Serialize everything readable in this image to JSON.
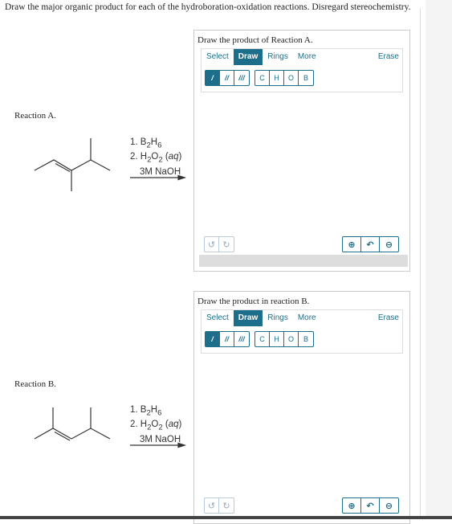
{
  "instructions": "Draw the major organic product for each of the hydroboration-oxidation reactions. Disregard stereochemistry.",
  "reactions": [
    {
      "label": "Reaction A.",
      "reagents": {
        "line1": "1. B",
        "line1_sub": "2",
        "line1_b": "H",
        "line1_sub2": "6",
        "line2": "2. H",
        "line2_sub": "2",
        "line2_b": "O",
        "line2_sub2": "2",
        "line2_c": " (",
        "line2_aq": "aq",
        "line2_d": ")",
        "line3": "3M NaOH"
      },
      "panel": {
        "title": "Draw the product of Reaction A.",
        "tabs": [
          "Select",
          "Draw",
          "Rings",
          "More"
        ],
        "active_tab": "Draw",
        "erase": "Erase",
        "bond_tools": [
          "/",
          "//",
          "///"
        ],
        "atoms": [
          "C",
          "H",
          "O",
          "B"
        ]
      }
    },
    {
      "label": "Reaction B.",
      "reagents": {
        "line1": "1. B",
        "line1_sub": "2",
        "line1_b": "H",
        "line1_sub2": "6",
        "line2": "2. H",
        "line2_sub": "2",
        "line2_b": "O",
        "line2_sub2": "2",
        "line2_c": " (",
        "line2_aq": "aq",
        "line2_d": ")",
        "line3": "3M NaOH"
      },
      "panel": {
        "title": "Draw the product in reaction B.",
        "tabs": [
          "Select",
          "Draw",
          "Rings",
          "More"
        ],
        "active_tab": "Draw",
        "erase": "Erase",
        "bond_tools": [
          "/",
          "//",
          "///"
        ],
        "atoms": [
          "C",
          "H",
          "O",
          "B"
        ]
      }
    }
  ],
  "icons": {
    "undo": "undo-icon",
    "redo": "redo-icon",
    "zoom_in": "zoom-in-icon",
    "reset": "reset-zoom-icon",
    "zoom_out": "zoom-out-icon"
  },
  "accent": "#1d6e8a"
}
